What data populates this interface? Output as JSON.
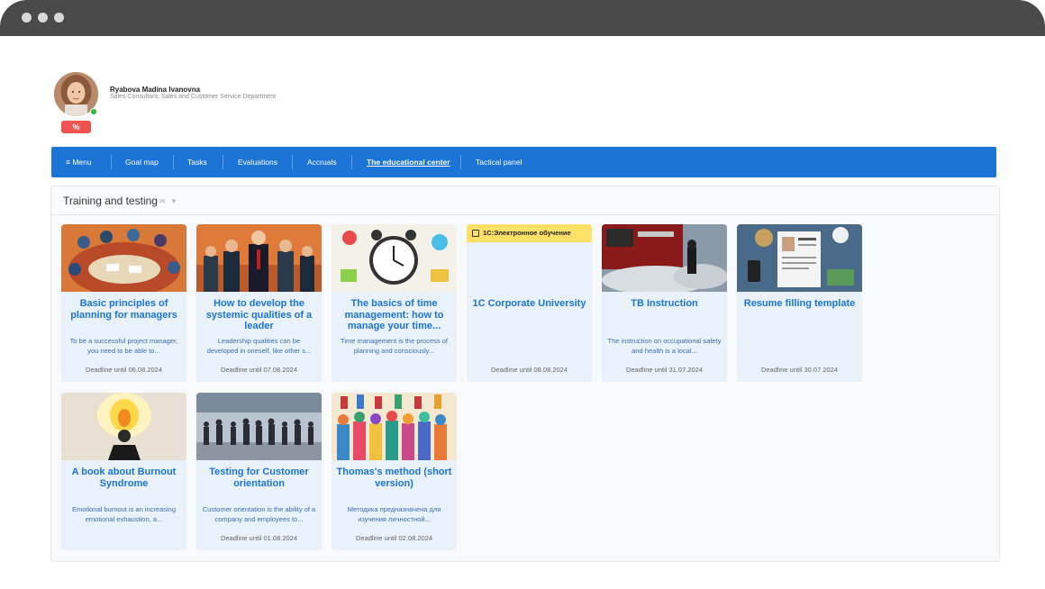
{
  "profile": {
    "name": "Ryabova Madina Ivanovna",
    "role": "Sales Consultant; Sales and Customer Service Department",
    "percent_badge": "%"
  },
  "nav": {
    "menu": "≡ Menu",
    "items": [
      "Goal map",
      "Tasks",
      "Evaluations",
      "Accruals",
      "The educational center",
      "Tactical panel"
    ],
    "active": "The educational center"
  },
  "section": {
    "title": "Training and testing",
    "icons": [
      "envelope-icon",
      "filter-icon"
    ]
  },
  "cards": [
    {
      "title": "Basic principles of planning for managers",
      "desc": "To be a successful project manager, you need to be able to...",
      "deadline": "Deadline until 06.08.2024",
      "image": "meeting-illustration"
    },
    {
      "title": "How to develop the systemic qualities of a leader",
      "desc": "Leadership qualities can be developed in oneself, like other s...",
      "deadline": "Deadline until 07.08.2024",
      "image": "leaders-illustration"
    },
    {
      "title": "The basics of time management: how to manage your time...",
      "desc": "Time management is the process of planning and consciously...",
      "deadline": "",
      "image": "clock-illustration"
    },
    {
      "title": "1C Corporate University",
      "desc": "",
      "deadline": "Deadline until 08.08.2024",
      "image": "1c-badge",
      "badge": "1С:Электронное обучение"
    },
    {
      "title": "TB Instruction",
      "desc": "The instruction on occupational safety and health is a local...",
      "deadline": "Deadline until 31.07.2024",
      "image": "firetruck-photo"
    },
    {
      "title": "Resume filling template",
      "desc": "",
      "deadline": "Deadline until 30.07.2024",
      "image": "resume-desk-illustration"
    },
    {
      "title": "A book about Burnout Syndrome",
      "desc": "Emotional burnout is an increasing emotional exhaustion, a...",
      "deadline": "",
      "image": "burning-head-illustration"
    },
    {
      "title": "Testing for Customer orientation",
      "desc": "Customer orientation is the ability of a company and employees to...",
      "deadline": "Deadline until 01.08.2024",
      "image": "crowd-illustration"
    },
    {
      "title": "Thomas's method (short version)",
      "desc": "Методика предназначена для изучения личностной...",
      "deadline": "Deadline until 02.08.2024",
      "image": "colorful-people-illustration"
    }
  ],
  "colors": {
    "nav": "#1b74d6",
    "card": "#e9f1fb",
    "accent": "#1b74d6",
    "badge1c": "#ffe066",
    "percent": "#ef5350"
  }
}
